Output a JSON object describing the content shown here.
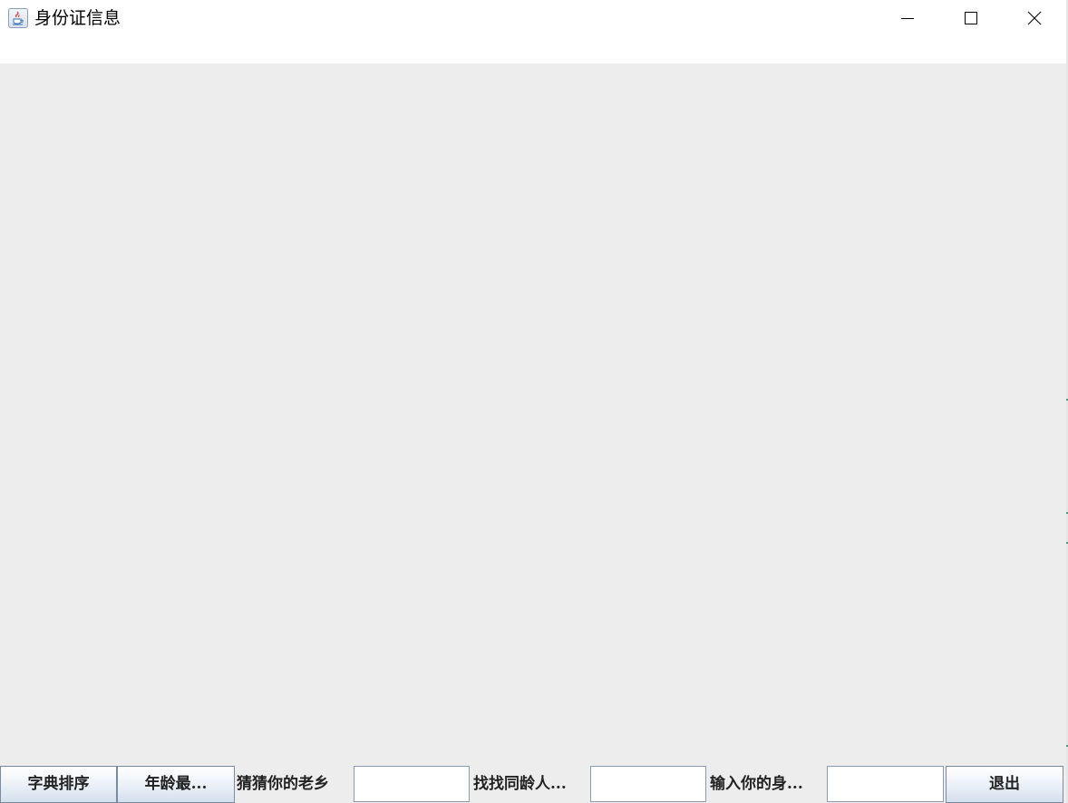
{
  "window": {
    "title": "身份证信息",
    "icon": "java-cup-icon"
  },
  "titlebar_buttons": {
    "minimize": "minimize-icon",
    "maximize": "maximize-icon",
    "close": "close-icon"
  },
  "toolbar": {
    "dictionary_sort_label": "字典排序",
    "age_max_label": "年龄最...",
    "guess_hometown_label": "猜猜你的老乡",
    "guess_hometown_value": "",
    "find_same_age_label": "找找同龄人...",
    "find_same_age_value": "",
    "enter_id_label": "输入你的身...",
    "enter_id_value": "",
    "exit_label": "退出"
  },
  "colors": {
    "content_background": "#ededed",
    "titlebar_background": "#ffffff",
    "button_gradient_top": "#ffffff",
    "button_gradient_bottom": "#d4e0ee",
    "button_border": "#7a8aa0"
  }
}
